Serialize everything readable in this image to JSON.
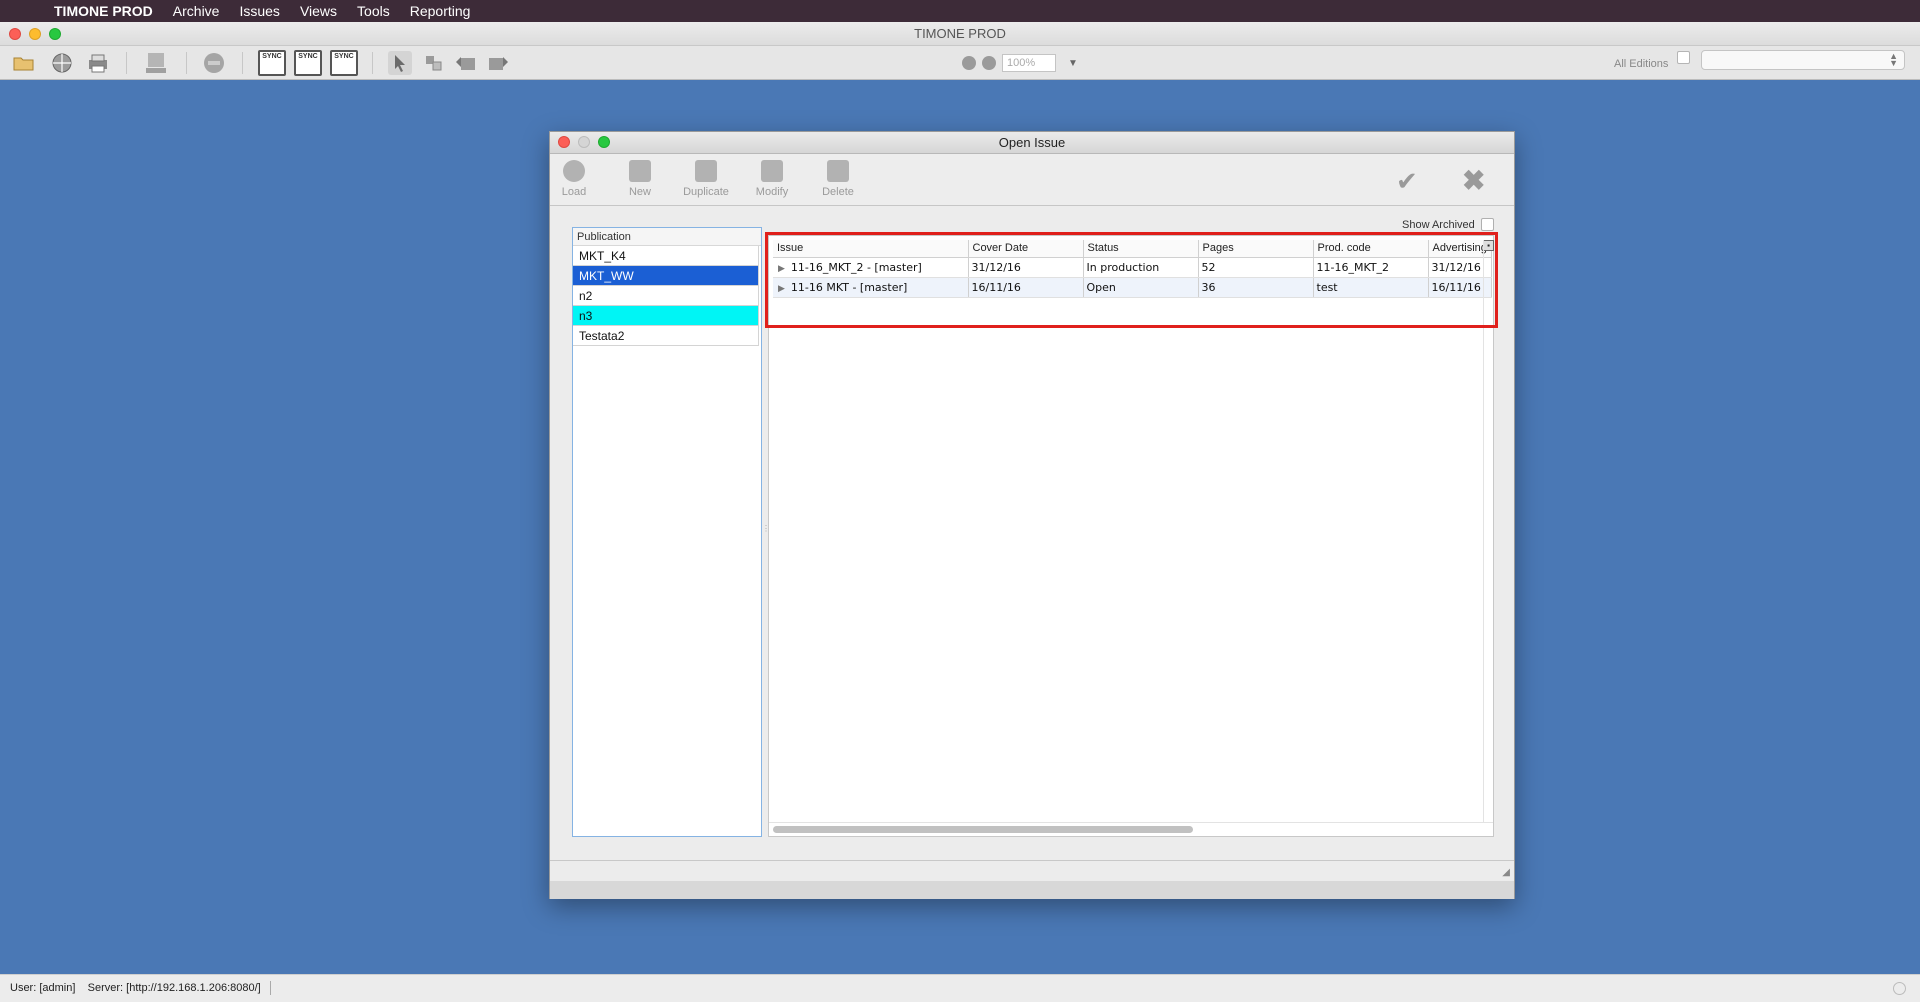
{
  "menubar": {
    "app_name": "TIMONE PROD",
    "items": [
      "Archive",
      "Issues",
      "Views",
      "Tools",
      "Reporting"
    ]
  },
  "app_window": {
    "title": "TIMONE PROD",
    "zoom_value": "100%",
    "editions_label": "All Editions"
  },
  "dialog": {
    "title": "Open Issue",
    "tools": [
      "Load",
      "New",
      "Duplicate",
      "Modify",
      "Delete"
    ],
    "show_archived_label": "Show Archived"
  },
  "publications": {
    "header": "Publication",
    "items": [
      "MKT_K4",
      "MKT_WW",
      "n2",
      "n3",
      "Testata2"
    ],
    "selected": "MKT_WW",
    "highlighted": "n3"
  },
  "issues": {
    "columns": [
      "Issue",
      "Cover Date",
      "Status",
      "Pages",
      "Prod. code",
      "Advertising"
    ],
    "rows": [
      {
        "issue": "11-16_MKT_2 - [master]",
        "cover_date": "31/12/16",
        "status": "In production",
        "pages": "52",
        "prod_code": "11-16_MKT_2",
        "advertising": "31/12/16"
      },
      {
        "issue": "11-16 MKT - [master]",
        "cover_date": "16/11/16",
        "status": "Open",
        "pages": "36",
        "prod_code": "test",
        "advertising": "16/11/16"
      }
    ]
  },
  "statusbar": {
    "user": "User: [admin]",
    "server": "Server: [http://192.168.1.206:8080/]"
  }
}
